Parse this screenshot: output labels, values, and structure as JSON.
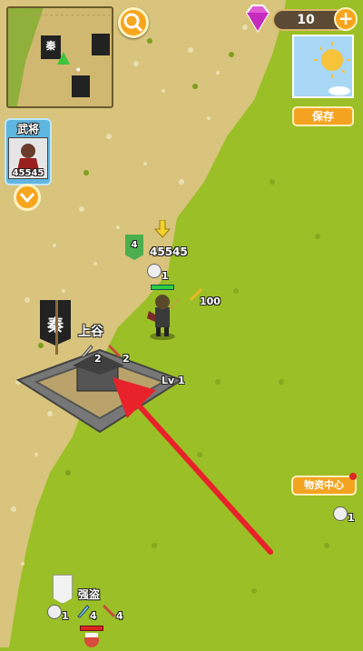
{
  "hud": {
    "gem_count": "10",
    "plus_label": "+",
    "save_label": "保存",
    "generals_title": "武将",
    "general_power": "45545",
    "supply_center_label": "物资中心",
    "minimap_flag_char": "秦"
  },
  "map": {
    "city": {
      "flag_char": "秦",
      "name": "上谷",
      "level_text": "Lv 1",
      "stat_left": "2",
      "stat_right": "2"
    },
    "army": {
      "flag_number": "4",
      "power": "45545",
      "food": "1",
      "attack_bonus": "100"
    },
    "bandit": {
      "name": "强盗",
      "food": "1",
      "stat_left": "4",
      "stat_right": "4"
    },
    "side_unit": {
      "food": "1"
    }
  },
  "colors": {
    "grass": "#9bbf26",
    "sand": "#d8c47c",
    "arrow": "#e8222a",
    "button": "#f7a51c"
  }
}
